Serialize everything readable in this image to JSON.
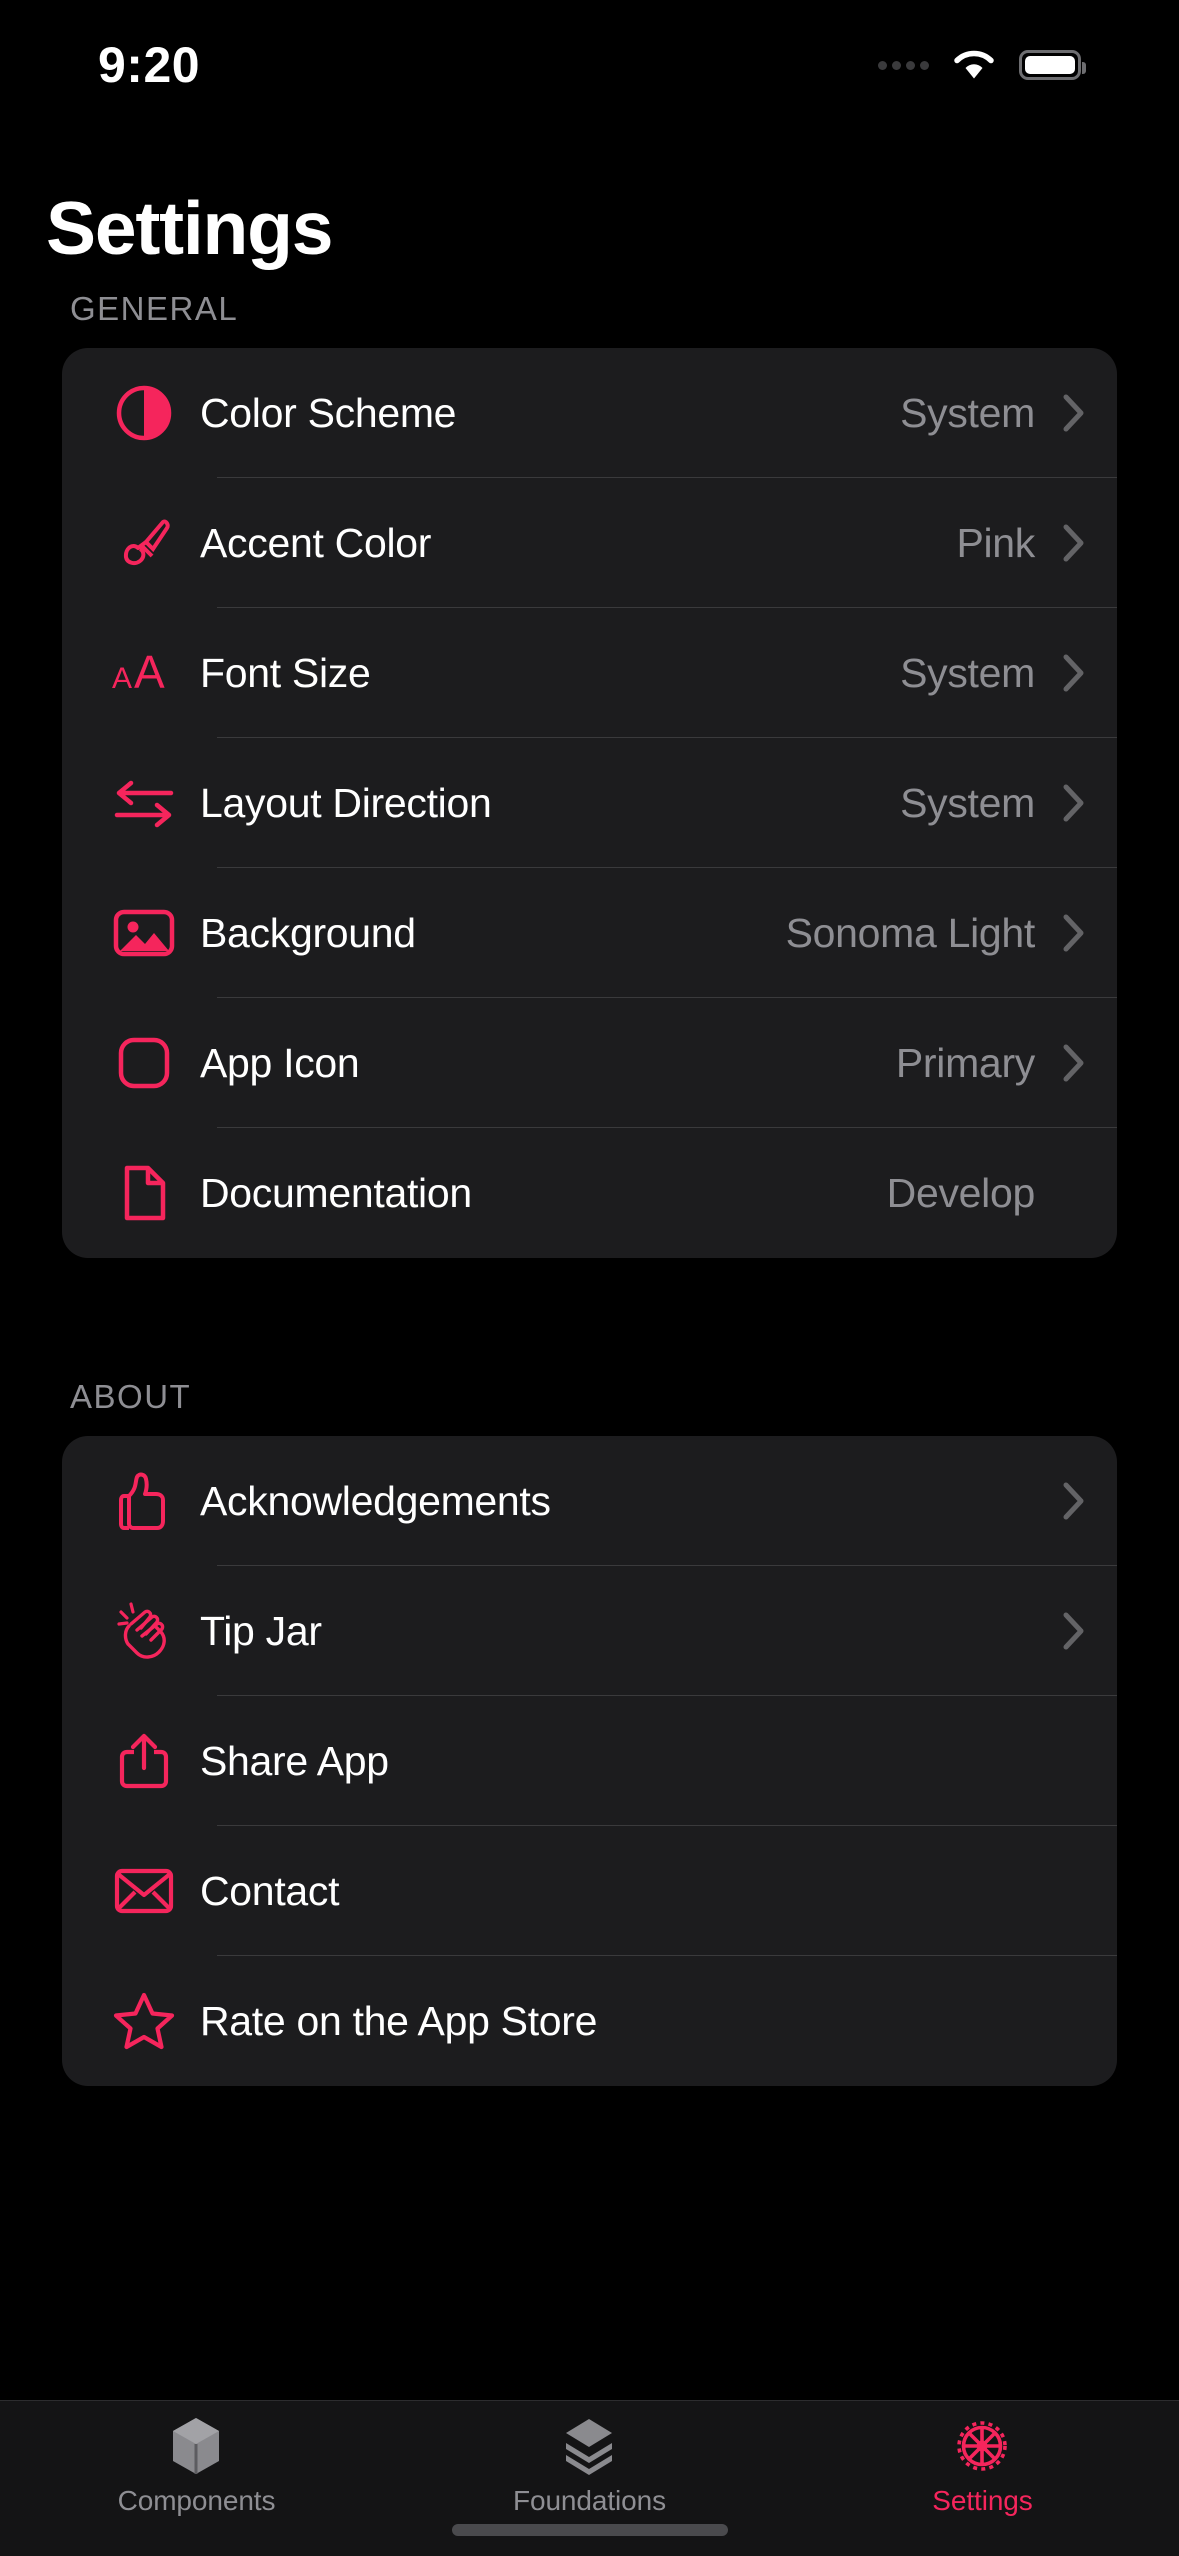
{
  "accent_color": "#F5255C",
  "background_color": "#000000",
  "card_color": "#1C1C1E",
  "secondary_text_color": "#8E8E93",
  "status_bar": {
    "time": "9:20",
    "signal_icon": "signal-dots-icon",
    "wifi_icon": "wifi-icon",
    "battery_icon": "battery-icon"
  },
  "header": {
    "title": "Settings"
  },
  "sections": [
    {
      "title": "GENERAL",
      "rows": [
        {
          "icon": "color-scheme-icon",
          "label": "Color Scheme",
          "value": "System",
          "chevron": true
        },
        {
          "icon": "paintbrush-icon",
          "label": "Accent Color",
          "value": "Pink",
          "chevron": true
        },
        {
          "icon": "font-size-icon",
          "label": "Font Size",
          "value": "System",
          "chevron": true
        },
        {
          "icon": "layout-direction-icon",
          "label": "Layout Direction",
          "value": "System",
          "chevron": true
        },
        {
          "icon": "background-image-icon",
          "label": "Background",
          "value": "Sonoma Light",
          "chevron": true
        },
        {
          "icon": "app-icon-square-icon",
          "label": "App Icon",
          "value": "Primary",
          "chevron": true
        },
        {
          "icon": "document-icon",
          "label": "Documentation",
          "value": "Develop",
          "chevron": false
        }
      ]
    },
    {
      "title": "ABOUT",
      "rows": [
        {
          "icon": "thumbs-up-icon",
          "label": "Acknowledgements",
          "value": "",
          "chevron": true
        },
        {
          "icon": "hands-clapping-icon",
          "label": "Tip Jar",
          "value": "",
          "chevron": true
        },
        {
          "icon": "share-icon",
          "label": "Share App",
          "value": "",
          "chevron": false
        },
        {
          "icon": "envelope-icon",
          "label": "Contact",
          "value": "",
          "chevron": false
        },
        {
          "icon": "star-icon",
          "label": "Rate on the App Store",
          "value": "",
          "chevron": false
        }
      ]
    }
  ],
  "tab_bar": {
    "tabs": [
      {
        "icon": "cube-icon",
        "label": "Components",
        "active": false
      },
      {
        "icon": "layers-icon",
        "label": "Foundations",
        "active": false
      },
      {
        "icon": "gear-icon",
        "label": "Settings",
        "active": true
      }
    ]
  }
}
